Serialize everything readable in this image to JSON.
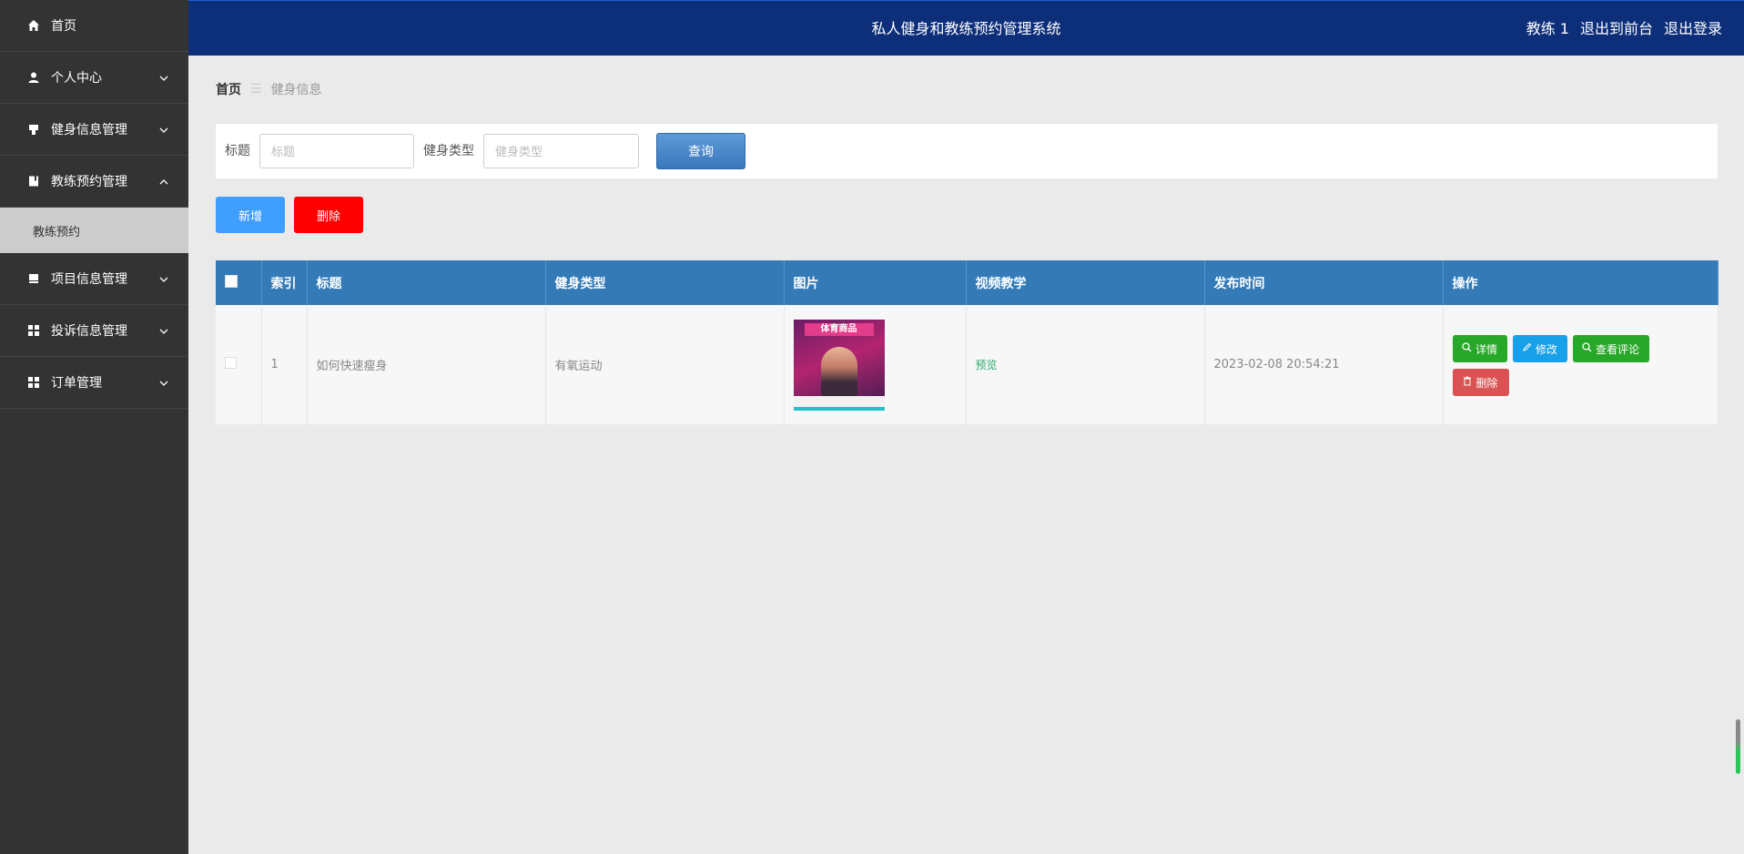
{
  "app": {
    "title": "私人健身和教练预约管理系统"
  },
  "topbar": {
    "user": "教练 1",
    "to_front": "退出到前台",
    "logout": "退出登录"
  },
  "sidebar": {
    "items": [
      {
        "label": "首页",
        "icon": "home-icon"
      },
      {
        "label": "个人中心",
        "icon": "user-icon"
      },
      {
        "label": "健身信息管理",
        "icon": "folder-icon"
      },
      {
        "label": "教练预约管理",
        "icon": "book-icon"
      },
      {
        "label": "项目信息管理",
        "icon": "folder-icon"
      },
      {
        "label": "投诉信息管理",
        "icon": "grid-icon"
      },
      {
        "label": "订单管理",
        "icon": "grid-icon"
      }
    ],
    "submenu": {
      "label": "教练预约"
    }
  },
  "breadcrumb": {
    "home": "首页",
    "sep": "☰",
    "current": "健身信息"
  },
  "search": {
    "title_label": "标题",
    "title_placeholder": "标题",
    "type_label": "健身类型",
    "type_placeholder": "健身类型",
    "query_button": "查询"
  },
  "actions": {
    "add": "新增",
    "delete": "删除"
  },
  "table": {
    "columns": [
      "索引",
      "标题",
      "健身类型",
      "图片",
      "视频教学",
      "发布时间",
      "操作"
    ],
    "rows": [
      {
        "index": "1",
        "title": "如何快速瘦身",
        "type": "有氧运动",
        "image_text": "体育商品",
        "video": "预览",
        "time": "2023-02-08 20:54:21",
        "ops": {
          "detail": "详情",
          "edit": "修改",
          "review": "查看评论",
          "delete": "删除"
        }
      }
    ]
  },
  "colors": {
    "sidebar_bg": "#333333",
    "topbar_bg": "#0d2f7a",
    "table_header": "#337ab7",
    "add_button": "#409eff",
    "delete_button": "#ff0000",
    "detail_button": "#28a828",
    "edit_button": "#18a0e8",
    "row_delete_button": "#d85352"
  }
}
